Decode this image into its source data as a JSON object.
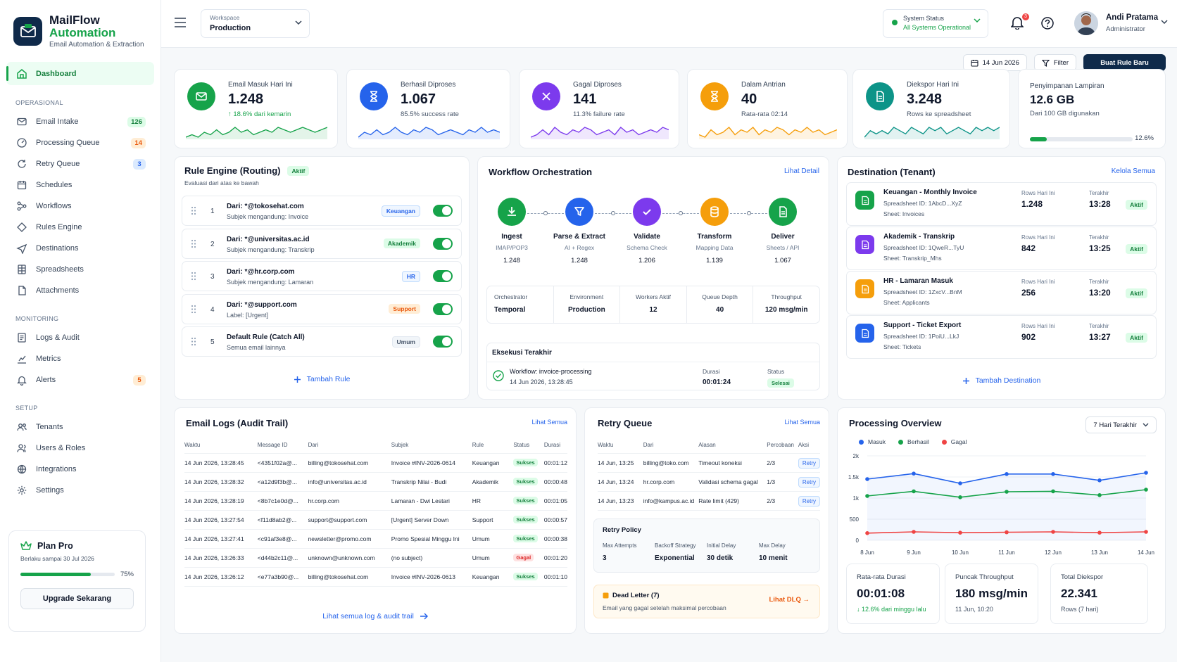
{
  "brand": {
    "title1": "MailFlow",
    "title2": "Automation",
    "subtitle": "Email Automation & Extraction"
  },
  "nav": {
    "dashboard": "Dashboard",
    "sec_ops": "OPERASIONAL",
    "sec_mon": "MONITORING",
    "sec_setup": "SETUP",
    "items": [
      {
        "label": "Email Intake",
        "badge": "126",
        "icon": "mail-icon"
      },
      {
        "label": "Processing Queue",
        "badge": "14",
        "icon": "gauge-icon"
      },
      {
        "label": "Retry Queue",
        "badge": "3",
        "icon": "refresh-icon"
      },
      {
        "label": "Schedules",
        "icon": "calendar-icon"
      },
      {
        "label": "Workflows",
        "icon": "workflow-icon"
      },
      {
        "label": "Rules Engine",
        "icon": "diamond-icon"
      },
      {
        "label": "Destinations",
        "icon": "send-icon"
      },
      {
        "label": "Spreadsheets",
        "icon": "spreadsheet-icon"
      },
      {
        "label": "Attachments",
        "icon": "file-icon"
      },
      {
        "label": "Logs & Audit",
        "icon": "log-icon"
      },
      {
        "label": "Metrics",
        "icon": "metrics-icon"
      },
      {
        "label": "Alerts",
        "badge": "5",
        "icon": "bell-icon"
      },
      {
        "label": "Tenants",
        "icon": "tenants-icon"
      },
      {
        "label": "Users & Roles",
        "icon": "users-icon"
      },
      {
        "label": "Integrations",
        "icon": "integrations-icon"
      },
      {
        "label": "Settings",
        "icon": "gear-icon"
      }
    ]
  },
  "plan": {
    "title": "Plan Pro",
    "sub": "Berlaku sampai 30 Jul 2026",
    "progress": 0.75,
    "pct": "75%",
    "button": "Upgrade Sekarang"
  },
  "topbar": {
    "ws_label": "Workspace",
    "ws_value": "Production",
    "sys_label": "System Status",
    "sys_value": "All Systems Operational",
    "bell_count": "3",
    "user_name": "Andi Pratama",
    "user_role": "Administrator"
  },
  "actions": {
    "date": "14 Jun 2026",
    "filter": "Filter",
    "new_rule": "Buat Rule Baru"
  },
  "kpis": [
    {
      "label": "Email Masuk Hari Ini",
      "value": "1.248",
      "sub": "↑ 18.6% dari kemarin",
      "color": "#16a34a",
      "spark": [
        5,
        6,
        5,
        7,
        6,
        8,
        6,
        7,
        9,
        7,
        8,
        6,
        7,
        8,
        7,
        9,
        8,
        7,
        8,
        9,
        8,
        7,
        8,
        9
      ]
    },
    {
      "label": "Berhasil Diproses",
      "value": "1.067",
      "sub": "85.5% success rate",
      "color": "#2563eb",
      "spark": [
        5,
        7,
        6,
        8,
        6,
        7,
        9,
        7,
        6,
        8,
        7,
        9,
        8,
        6,
        7,
        8,
        7,
        6,
        8,
        7,
        9,
        7,
        8,
        7
      ]
    },
    {
      "label": "Gagal Diproses",
      "value": "141",
      "sub": "11.3% failure rate",
      "color": "#7c3aed",
      "spark": [
        5,
        6,
        8,
        6,
        9,
        7,
        6,
        8,
        7,
        9,
        8,
        6,
        7,
        8,
        6,
        9,
        7,
        8,
        6,
        7,
        8,
        7,
        9,
        8
      ]
    },
    {
      "label": "Dalam Antrian",
      "value": "40",
      "sub": "Rata-rata 02:14",
      "color": "#f59e0b",
      "spark": [
        6,
        5,
        8,
        6,
        7,
        9,
        6,
        8,
        7,
        9,
        6,
        8,
        7,
        9,
        8,
        6,
        8,
        7,
        9,
        7,
        8,
        6,
        7,
        8
      ]
    },
    {
      "label": "Diekspor Hari Ini",
      "value": "3.248",
      "sub": "Rows ke spreadsheet",
      "color": "#0d9488",
      "spark": [
        5,
        7,
        6,
        7,
        6,
        8,
        7,
        6,
        8,
        7,
        6,
        8,
        7,
        8,
        6,
        7,
        8,
        7,
        6,
        8,
        7,
        8,
        7,
        8
      ]
    },
    {
      "label": "Penyimpanan Lampiran",
      "value": "12.6 GB",
      "sub": "Dari 100 GB digunakan",
      "pct": "12.6%",
      "progress": 0.126
    }
  ],
  "rules": {
    "title": "Rule Engine (Routing)",
    "status": "Aktif",
    "subtitle": "Evaluasi dari atas ke bawah",
    "add": "Tambah Rule",
    "items": [
      {
        "num": "1",
        "from": "Dari: *@tokosehat.com",
        "cond": "Subjek mengandung: Invoice",
        "tag": "Keuangan",
        "tag_style": "p-blue"
      },
      {
        "num": "2",
        "from": "Dari: *@universitas.ac.id",
        "cond": "Subjek mengandung: Transkrip",
        "tag": "Akademik",
        "tag_style": "p-green"
      },
      {
        "num": "3",
        "from": "Dari: *@hr.corp.com",
        "cond": "Subjek mengandung: Lamaran",
        "tag": "HR",
        "tag_style": "p-blue"
      },
      {
        "num": "4",
        "from": "Dari: *@support.com",
        "cond": "Label: [Urgent]",
        "tag": "Support",
        "tag_style": "p-orange"
      },
      {
        "num": "5",
        "from": "Default Rule (Catch All)",
        "cond": "Semua email lainnya",
        "tag": "Umum",
        "tag_style": "p-gray"
      }
    ]
  },
  "workflow": {
    "title": "Workflow Orchestration",
    "link": "Lihat Detail",
    "steps": [
      {
        "name": "Ingest",
        "sub": "IMAP/POP3",
        "value": "1.248",
        "color": "#16a34a",
        "icon": "download-icon"
      },
      {
        "name": "Parse & Extract",
        "sub": "AI + Regex",
        "value": "1.248",
        "color": "#2563eb",
        "icon": "filter-icon"
      },
      {
        "name": "Validate",
        "sub": "Schema Check",
        "value": "1.206",
        "color": "#7c3aed",
        "icon": "check-icon"
      },
      {
        "name": "Transform",
        "sub": "Mapping Data",
        "value": "1.139",
        "color": "#f59e0b",
        "icon": "database-icon"
      },
      {
        "name": "Deliver",
        "sub": "Sheets / API",
        "value": "1.067",
        "color": "#16a34a",
        "icon": "document-icon"
      }
    ],
    "stats": [
      {
        "label": "Orchestrator",
        "value": "Temporal"
      },
      {
        "label": "Environment",
        "value": "Production"
      },
      {
        "label": "Workers Aktif",
        "value": "12"
      },
      {
        "label": "Queue Depth",
        "value": "40"
      },
      {
        "label": "Throughput",
        "value": "120 msg/min"
      }
    ],
    "recent_title": "Eksekusi Terakhir",
    "recent_name": "Workflow: invoice-processing",
    "recent_time": "14 Jun 2026, 13:28:45",
    "duration_label": "Durasi",
    "duration": "00:01:24",
    "status_label": "Status",
    "status": "Selesai"
  },
  "destinations": {
    "title": "Destination (Tenant)",
    "link": "Kelola Semua",
    "add": "Tambah Destination",
    "rows_label": "Rows Hari Ini",
    "last_label": "Terakhir",
    "items": [
      {
        "name": "Keuangan - Monthly Invoice",
        "sheet_id": "Spreadsheet ID: 1AbcD...XyZ",
        "sheet": "Sheet: Invoices",
        "rows": "1.248",
        "last": "13:28",
        "status": "Aktif",
        "color": "#16a34a"
      },
      {
        "name": "Akademik - Transkrip",
        "sheet_id": "Spreadsheet ID: 1QweR...TyU",
        "sheet": "Sheet: Transkrip_Mhs",
        "rows": "842",
        "last": "13:25",
        "status": "Aktif",
        "color": "#7c3aed"
      },
      {
        "name": "HR - Lamaran Masuk",
        "sheet_id": "Spreadsheet ID: 1ZxcV...BnM",
        "sheet": "Sheet: Applicants",
        "rows": "256",
        "last": "13:20",
        "status": "Aktif",
        "color": "#f59e0b"
      },
      {
        "name": "Support - Ticket Export",
        "sheet_id": "Spreadsheet ID: 1PoiU...LkJ",
        "sheet": "Sheet: Tickets",
        "rows": "902",
        "last": "13:27",
        "status": "Aktif",
        "color": "#2563eb"
      }
    ]
  },
  "logs": {
    "title": "Email Logs (Audit Trail)",
    "link": "Lihat Semua",
    "footer": "Lihat semua log & audit trail",
    "headers": [
      "Waktu",
      "Message ID",
      "Dari",
      "Subjek",
      "Rule",
      "Status",
      "Durasi"
    ],
    "rows": [
      [
        "14 Jun 2026, 13:28:45",
        "<4351f02a@...",
        "billing@tokosehat.com",
        "Invoice #INV-2026-0614",
        "Keuangan",
        "Sukses",
        "00:01:12"
      ],
      [
        "14 Jun 2026, 13:28:32",
        "<a12d9f3b@...",
        "info@universitas.ac.id",
        "Transkrip Nilai - Budi",
        "Akademik",
        "Sukses",
        "00:00:48"
      ],
      [
        "14 Jun 2026, 13:28:19",
        "<8b7c1e0d@...",
        "hr.corp.com",
        "Lamaran - Dwi Lestari",
        "HR",
        "Sukses",
        "00:01:05"
      ],
      [
        "14 Jun 2026, 13:27:54",
        "<f11d8ab2@...",
        "support@support.com",
        "[Urgent] Server Down",
        "Support",
        "Sukses",
        "00:00:57"
      ],
      [
        "14 Jun 2026, 13:27:41",
        "<c91af3e8@...",
        "newsletter@promo.com",
        "Promo Spesial Minggu Ini",
        "Umum",
        "Sukses",
        "00:00:38"
      ],
      [
        "14 Jun 2026, 13:26:33",
        "<d44b2c11@...",
        "unknown@unknown.com",
        "(no subject)",
        "Umum",
        "Gagal",
        "00:01:20"
      ],
      [
        "14 Jun 2026, 13:26:12",
        "<e77a3b90@...",
        "billing@tokosehat.com",
        "Invoice #INV-2026-0613",
        "Keuangan",
        "Sukses",
        "00:01:10"
      ]
    ]
  },
  "retry": {
    "title": "Retry Queue",
    "link": "Lihat Semua",
    "headers": [
      "Waktu",
      "Dari",
      "Alasan",
      "Percobaan",
      "Aksi"
    ],
    "rows": [
      [
        "14 Jun, 13:25",
        "billing@toko.com",
        "Timeout koneksi",
        "2/3",
        "Retry"
      ],
      [
        "14 Jun, 13:24",
        "hr.corp.com",
        "Validasi schema gagal",
        "1/3",
        "Retry"
      ],
      [
        "14 Jun, 13:23",
        "info@kampus.ac.id",
        "Rate limit (429)",
        "2/3",
        "Retry"
      ]
    ],
    "policy_title": "Retry Policy",
    "policy": [
      {
        "label": "Max Attempts",
        "value": "3"
      },
      {
        "label": "Backoff Strategy",
        "value": "Exponential"
      },
      {
        "label": "Initial Delay",
        "value": "30 detik"
      },
      {
        "label": "Max Delay",
        "value": "10 menit"
      }
    ],
    "dlq_title": "Dead Letter (7)",
    "dlq_sub": "Email yang gagal setelah maksimal percobaan",
    "dlq_link": "Lihat DLQ"
  },
  "overview": {
    "title": "Processing Overview",
    "range": "7 Hari Terakhir",
    "mini": [
      {
        "label": "Rata-rata Durasi",
        "value": "00:01:08",
        "sub": "↓ 12.6% dari minggu lalu"
      },
      {
        "label": "Puncak Throughput",
        "value": "180 msg/min",
        "sub": "11 Jun, 10:20"
      },
      {
        "label": "Total Diekspor",
        "value": "22.341",
        "sub": "Rows (7 hari)"
      }
    ]
  },
  "chart_data": {
    "type": "line",
    "categories": [
      "8 Jun",
      "9 Jun",
      "10 Jun",
      "11 Jun",
      "12 Jun",
      "13 Jun",
      "14 Jun"
    ],
    "yticks": [
      "2k",
      "1.5k",
      "1k",
      "500",
      "0"
    ],
    "ylim": [
      0,
      2000
    ],
    "grid": true,
    "legend": "top-left",
    "series": [
      {
        "name": "Masuk",
        "color": "#2563eb",
        "values": [
          1450,
          1580,
          1350,
          1570,
          1570,
          1420,
          1600
        ]
      },
      {
        "name": "Berhasil",
        "color": "#16a34a",
        "values": [
          1050,
          1160,
          1020,
          1150,
          1160,
          1070,
          1200
        ]
      },
      {
        "name": "Gagal",
        "color": "#ef4444",
        "values": [
          170,
          200,
          180,
          190,
          200,
          180,
          200
        ]
      }
    ]
  }
}
